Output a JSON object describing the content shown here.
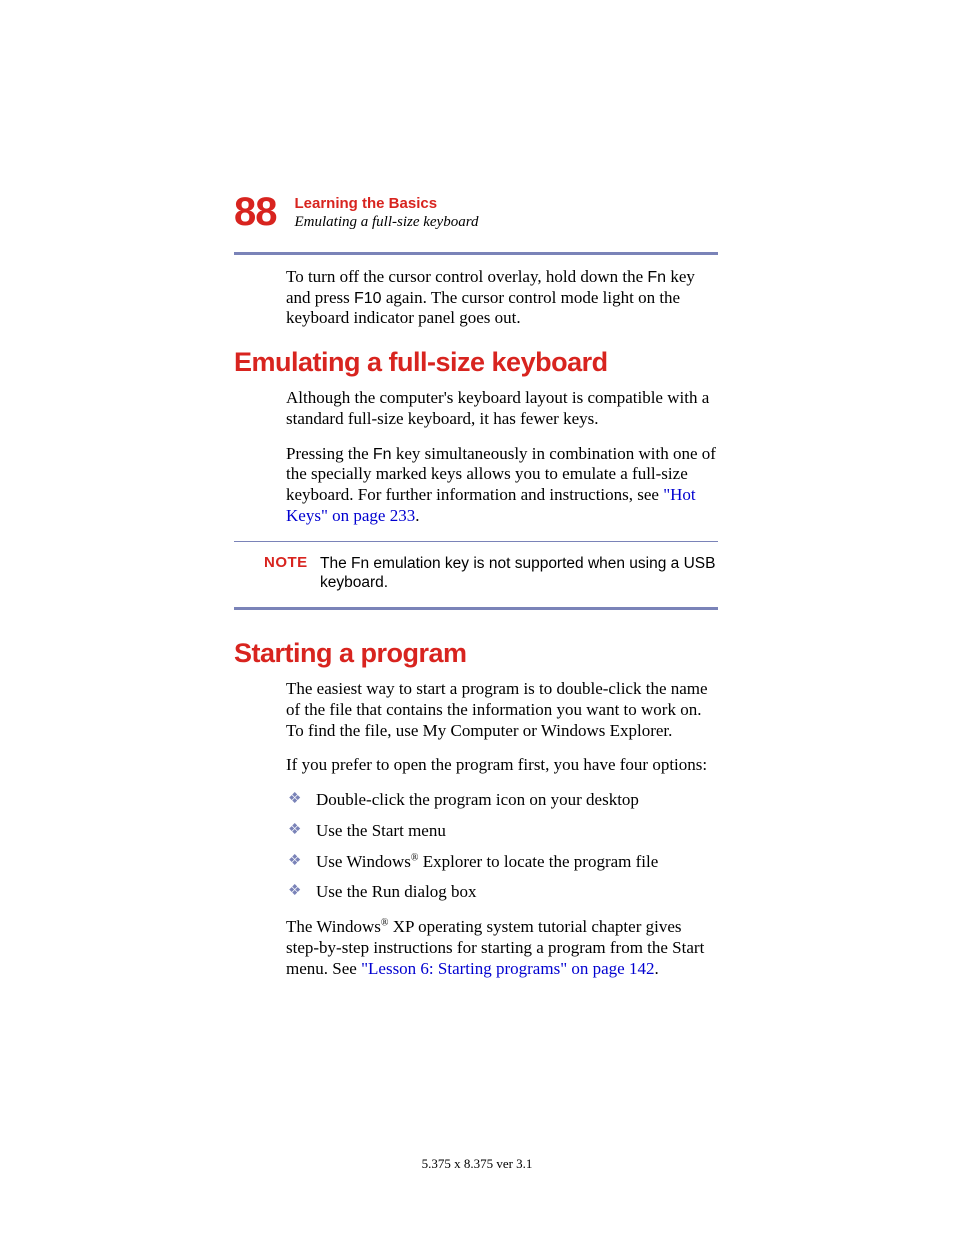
{
  "header": {
    "page_number": "88",
    "chapter": "Learning the Basics",
    "subtitle": "Emulating a full-size keyboard"
  },
  "intro": {
    "p1_a": "To turn off the cursor control overlay, hold down the ",
    "p1_fn": "Fn",
    "p1_b": " key and press ",
    "p1_f10": "F10",
    "p1_c": " again. The cursor control mode light on the keyboard indicator panel goes out."
  },
  "section1": {
    "heading": "Emulating a full-size keyboard",
    "p1": "Although the computer's keyboard layout is compatible with a standard full-size keyboard, it has fewer keys.",
    "p2_a": "Pressing the ",
    "p2_fn": "Fn",
    "p2_b": " key simultaneously in combination with one of the specially marked keys allows you to emulate a full-size keyboard. For further information and instructions, see ",
    "p2_link": "\"Hot Keys\" on page 233",
    "p2_c": "."
  },
  "note": {
    "label": "NOTE",
    "text": "The Fn emulation key is not supported when using a USB keyboard."
  },
  "section2": {
    "heading": "Starting a program",
    "p1": "The easiest way to start a program is to double-click the name of the file that contains the information you want to work on. To find the file, use My Computer or Windows Explorer.",
    "p2": "If you prefer to open the program first, you have four options:",
    "bullets": {
      "b1": "Double-click the program icon on your desktop",
      "b2": "Use the Start menu",
      "b3_a": "Use Windows",
      "b3_b": " Explorer to locate the program file",
      "b4": "Use the Run dialog box"
    },
    "p3_a": "The Windows",
    "p3_b": " XP operating system tutorial chapter gives step-by-step instructions for starting a program from the Start menu. See ",
    "p3_link": "\"Lesson 6: Starting programs\" on page 142",
    "p3_c": "."
  },
  "footer": "5.375 x 8.375 ver 3.1",
  "reg": "®"
}
